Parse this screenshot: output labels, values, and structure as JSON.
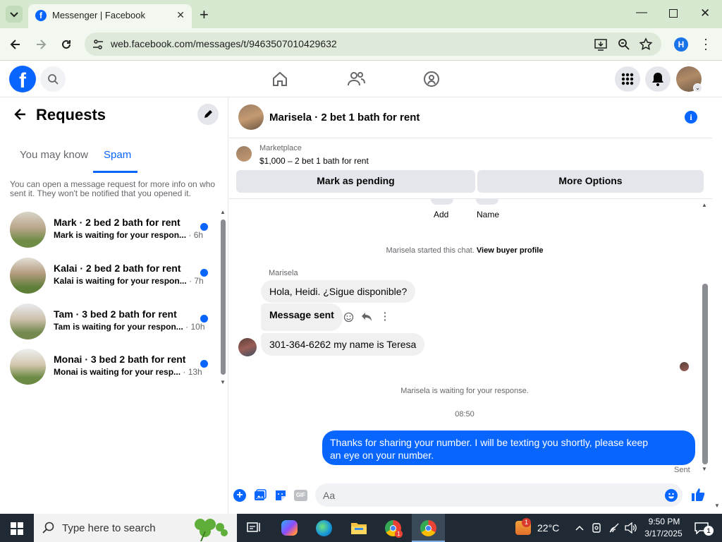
{
  "browser": {
    "tab_title": "Messenger | Facebook",
    "url": "web.facebook.com/messages/t/9463507010429632",
    "profile_letter": "H"
  },
  "left": {
    "title": "Requests",
    "tabs": [
      "You may know",
      "Spam"
    ],
    "active_tab": "Spam",
    "info": "You can open a message request for more info on who sent it. They won't be notified that you opened it.",
    "items": [
      {
        "name": "Mark · 2 bed 2 bath for rent",
        "sub": "Mark is waiting for your respon...",
        "time": "· 6h"
      },
      {
        "name": "Kalai · 2 bed 2 bath for rent",
        "sub": "Kalai is waiting for your respon...",
        "time": "· 7h"
      },
      {
        "name": "Tam · 3 bed 2 bath for rent",
        "sub": "Tam is waiting for your respon...",
        "time": "· 10h"
      },
      {
        "name": "Monai · 3 bed 2 bath for rent",
        "sub": "Monai is waiting for your resp...",
        "time": "· 13h"
      }
    ]
  },
  "chat": {
    "title": "Marisela · 2 bet 1 bath for rent",
    "marketplace_label": "Marketplace",
    "listing": "$1,000 – 2 bet 1 bath for rent",
    "mark_pending": "Mark as pending",
    "more_options": "More Options",
    "add_label": "Add",
    "name_label": "Name",
    "started": "Marisela started this chat.",
    "view_profile": "View buyer profile",
    "sender": "Marisela",
    "msg1": "Hola, Heidi. ¿Sigue disponible?",
    "msg2": "Message sent",
    "msg3": "301-364-6262 my name is Teresa",
    "waiting": "Marisela is waiting for your response.",
    "time": "08:50",
    "outgoing": "Thanks for sharing your number. I will be texting you shortly, please keep an eye on your number.",
    "sent": "Sent",
    "composer_placeholder": "Aa",
    "gif": "GIF"
  },
  "taskbar": {
    "search_placeholder": "Type here to search",
    "temp": "22°C",
    "weather_badge": "1",
    "time": "9:50 PM",
    "date": "3/17/2025",
    "notif": "1"
  },
  "colors": {
    "accent": "#0866ff",
    "tabbar": "#d6e8d0"
  }
}
